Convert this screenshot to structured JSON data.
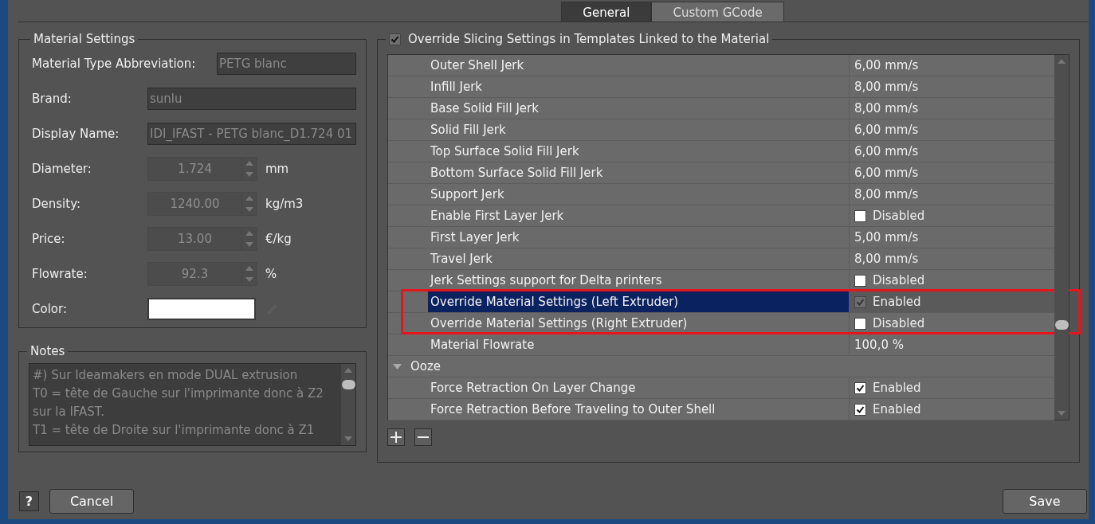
{
  "tabs": [
    {
      "label": "General",
      "selected": true
    },
    {
      "label": "Custom GCode",
      "selected": false
    }
  ],
  "material_settings": {
    "title": "Material Settings",
    "fields": [
      {
        "kind": "text",
        "label": "Material Type Abbreviation:",
        "value": "PETG blanc"
      },
      {
        "kind": "text",
        "label": "Brand:",
        "value": "sunlu"
      },
      {
        "kind": "text",
        "label": "Display Name:",
        "value": "IDI_IFAST - PETG blanc_D1.724 01"
      },
      {
        "kind": "spin",
        "label": "Diameter:",
        "value": "1.724",
        "unit": "mm"
      },
      {
        "kind": "spin",
        "label": "Density:",
        "value": "1240.00",
        "unit": "kg/m3"
      },
      {
        "kind": "spin",
        "label": "Price:",
        "value": "13.00",
        "unit": "€/kg"
      },
      {
        "kind": "spin",
        "label": "Flowrate:",
        "value": "92.3",
        "unit": "%"
      },
      {
        "kind": "color",
        "label": "Color:",
        "color": "#ffffff"
      }
    ]
  },
  "notes": {
    "title": "Notes",
    "text": "#) Sur Ideamakers en mode DUAL extrusion\nT0 = tête de Gauche sur l'imprimante donc à Z2\nsur la IFAST.\nT1 = tête de Droite sur l'imprimante donc à Z1"
  },
  "override": {
    "label": "Override Slicing Settings in Templates Linked to the Material",
    "checked": true
  },
  "settings": [
    {
      "kind": "value",
      "name": "Outer Shell Jerk",
      "value": "6,00 mm/s",
      "selected": false
    },
    {
      "kind": "value",
      "name": "Infill Jerk",
      "value": "8,00 mm/s",
      "selected": false
    },
    {
      "kind": "value",
      "name": "Base Solid Fill Jerk",
      "value": "8,00 mm/s",
      "selected": false
    },
    {
      "kind": "value",
      "name": "Solid Fill Jerk",
      "value": "6,00 mm/s",
      "selected": false
    },
    {
      "kind": "value",
      "name": "Top Surface Solid Fill Jerk",
      "value": "6,00 mm/s",
      "selected": false
    },
    {
      "kind": "value",
      "name": "Bottom Surface Solid Fill Jerk",
      "value": "6,00 mm/s",
      "selected": false
    },
    {
      "kind": "value",
      "name": "Support Jerk",
      "value": "8,00 mm/s",
      "selected": false
    },
    {
      "kind": "toggle",
      "name": "Enable First Layer Jerk",
      "value": "Disabled",
      "checked": false,
      "selected": false
    },
    {
      "kind": "value",
      "name": "First Layer Jerk",
      "value": "5,00 mm/s",
      "selected": false
    },
    {
      "kind": "value",
      "name": "Travel Jerk",
      "value": "8,00 mm/s",
      "selected": false
    },
    {
      "kind": "toggle",
      "name": "Jerk Settings support for Delta printers",
      "value": "Disabled",
      "checked": false,
      "selected": false
    },
    {
      "kind": "toggle",
      "name": "Override Material Settings (Left Extruder)",
      "value": "Enabled",
      "checked": true,
      "selected": true
    },
    {
      "kind": "toggle",
      "name": "Override Material Settings (Right Extruder)",
      "value": "Disabled",
      "checked": false,
      "selected": false
    },
    {
      "kind": "value",
      "name": "Material Flowrate",
      "value": "100,0 %",
      "selected": false
    },
    {
      "kind": "group",
      "name": "Ooze",
      "expanded": true,
      "selected": false
    },
    {
      "kind": "toggle",
      "name": "Force Retraction On Layer Change",
      "value": "Enabled",
      "checked": true,
      "selected": false
    },
    {
      "kind": "toggle",
      "name": "Force Retraction Before Traveling to Outer Shell",
      "value": "Enabled",
      "checked": true,
      "selected": false
    }
  ],
  "buttons": {
    "help": "?",
    "cancel": "Cancel",
    "save": "Save"
  }
}
